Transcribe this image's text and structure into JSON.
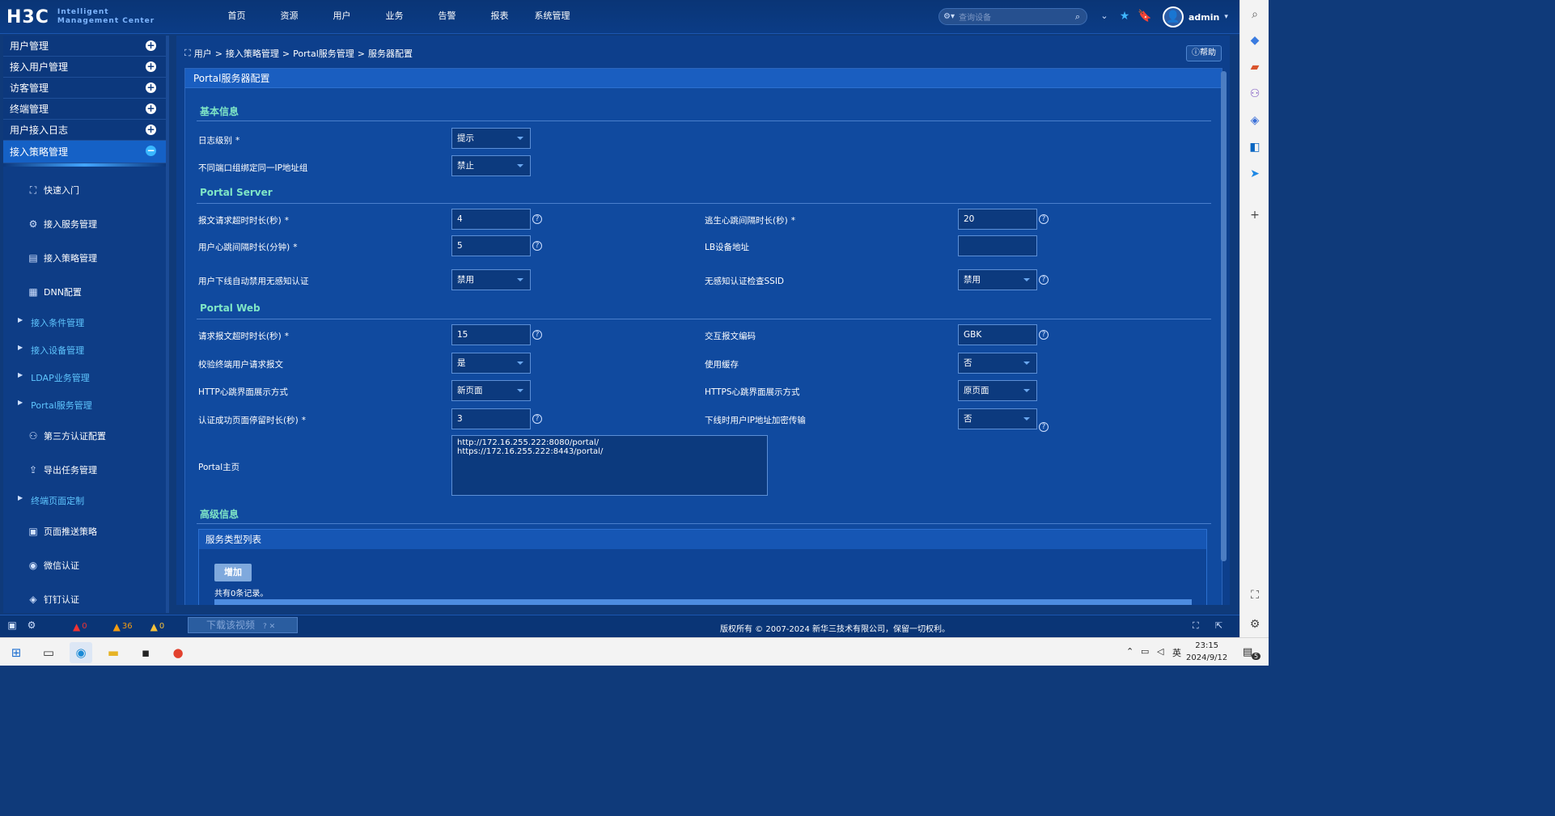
{
  "header": {
    "logo": "H3C",
    "logo_sub_line1": "Intelligent",
    "logo_sub_line2": "Management Center",
    "nav": [
      "首页",
      "资源",
      "用户",
      "业务",
      "告警",
      "报表",
      "系统管理"
    ],
    "search_placeholder": "查询设备",
    "username": "admin"
  },
  "sidebar": {
    "groups": [
      {
        "label": "用户管理",
        "toggle": "+"
      },
      {
        "label": "接入用户管理",
        "toggle": "+"
      },
      {
        "label": "访客管理",
        "toggle": "+"
      },
      {
        "label": "终端管理",
        "toggle": "+"
      },
      {
        "label": "用户接入日志",
        "toggle": "+"
      }
    ],
    "active_group": {
      "label": "接入策略管理",
      "toggle": "−"
    },
    "items": [
      {
        "label": "快速入门",
        "icon": "quickstart-icon",
        "glyph": "⛶",
        "kind": "item"
      },
      {
        "label": "接入服务管理",
        "icon": "service-icon",
        "glyph": "⚙",
        "kind": "item"
      },
      {
        "label": "接入策略管理",
        "icon": "policy-icon",
        "glyph": "▤",
        "kind": "item"
      },
      {
        "label": "DNN配置",
        "icon": "dnn-icon",
        "glyph": "▦",
        "kind": "item"
      },
      {
        "label": "接入条件管理",
        "kind": "sub"
      },
      {
        "label": "接入设备管理",
        "kind": "sub"
      },
      {
        "label": "LDAP业务管理",
        "kind": "sub"
      },
      {
        "label": "Portal服务管理",
        "kind": "sub"
      },
      {
        "label": "第三方认证配置",
        "icon": "thirdparty-icon",
        "glyph": "⚇",
        "kind": "item"
      },
      {
        "label": "导出任务管理",
        "icon": "export-icon",
        "glyph": "⇪",
        "kind": "item"
      },
      {
        "label": "终端页面定制",
        "kind": "sub"
      },
      {
        "label": "页面推送策略",
        "icon": "push-icon",
        "glyph": "▣",
        "kind": "item"
      },
      {
        "label": "微信认证",
        "icon": "wechat-icon",
        "glyph": "◉",
        "kind": "item"
      },
      {
        "label": "钉钉认证",
        "icon": "dingtalk-icon",
        "glyph": "◈",
        "kind": "item"
      }
    ]
  },
  "breadcrumb": [
    "用户",
    ">",
    "接入策略管理",
    ">",
    "Portal服务管理",
    ">",
    "服务器配置"
  ],
  "help_label": "帮助",
  "panel_title": "Portal服务器配置",
  "sections": {
    "basic": "基本信息",
    "server": "Portal Server",
    "web": "Portal Web",
    "advanced": "高级信息"
  },
  "fields": {
    "log_level": {
      "label": "日志级别",
      "value": "提示"
    },
    "bind_ip_group": {
      "label": "不同端口组绑定同一IP地址组",
      "value": "禁止"
    },
    "req_timeout": {
      "label": "报文请求超时时长(秒)",
      "value": "4"
    },
    "escape_heartbeat": {
      "label": "逃生心跳间隔时长(秒)",
      "value": "20"
    },
    "user_heartbeat": {
      "label": "用户心跳间隔时长(分钟)",
      "value": "5"
    },
    "lb_device": {
      "label": "LB设备地址",
      "value": ""
    },
    "offline_disable": {
      "label": "用户下线自动禁用无感知认证",
      "value": "禁用"
    },
    "check_ssid": {
      "label": "无感知认证检查SSID",
      "value": "禁用"
    },
    "web_req_timeout": {
      "label": "请求报文超时时长(秒)",
      "value": "15"
    },
    "encoding": {
      "label": "交互报文编码",
      "value": "GBK"
    },
    "verify_req": {
      "label": "校验终端用户请求报文",
      "value": "是"
    },
    "use_cache": {
      "label": "使用缓存",
      "value": "否"
    },
    "http_heartbeat": {
      "label": "HTTP心跳界面展示方式",
      "value": "新页面"
    },
    "https_heartbeat": {
      "label": "HTTPS心跳界面展示方式",
      "value": "原页面"
    },
    "success_stay": {
      "label": "认证成功页面停留时长(秒)",
      "value": "3"
    },
    "encrypt_ip": {
      "label": "下线时用户IP地址加密传输",
      "value": "否"
    },
    "portal_home": {
      "label": "Portal主页",
      "line1": "http://172.16.255.222:8080/portal/",
      "line2": "https://172.16.255.222:8443/portal/"
    }
  },
  "required_mark": "*",
  "service_list": {
    "title": "服务类型列表",
    "add_label": "增加",
    "record_text": "共有0条记录。"
  },
  "statusbar": {
    "alarm_critical": "0",
    "alarm_major": "36",
    "alarm_minor": "0",
    "download_text": "下载该视频",
    "copyright": "版权所有 © 2007-2024 新华三技术有限公司，保留一切权利。"
  },
  "taskbar": {
    "time": "23:15",
    "date": "2024/9/12",
    "ime": "英",
    "notif_count": "5"
  },
  "colors": {
    "page_bg": "#0d3f8c",
    "panel_header": "#1a5ec0",
    "section_title": "#7fe6c6",
    "sidebar_sub": "#5fc6ff",
    "active_group": "#1561c6"
  }
}
